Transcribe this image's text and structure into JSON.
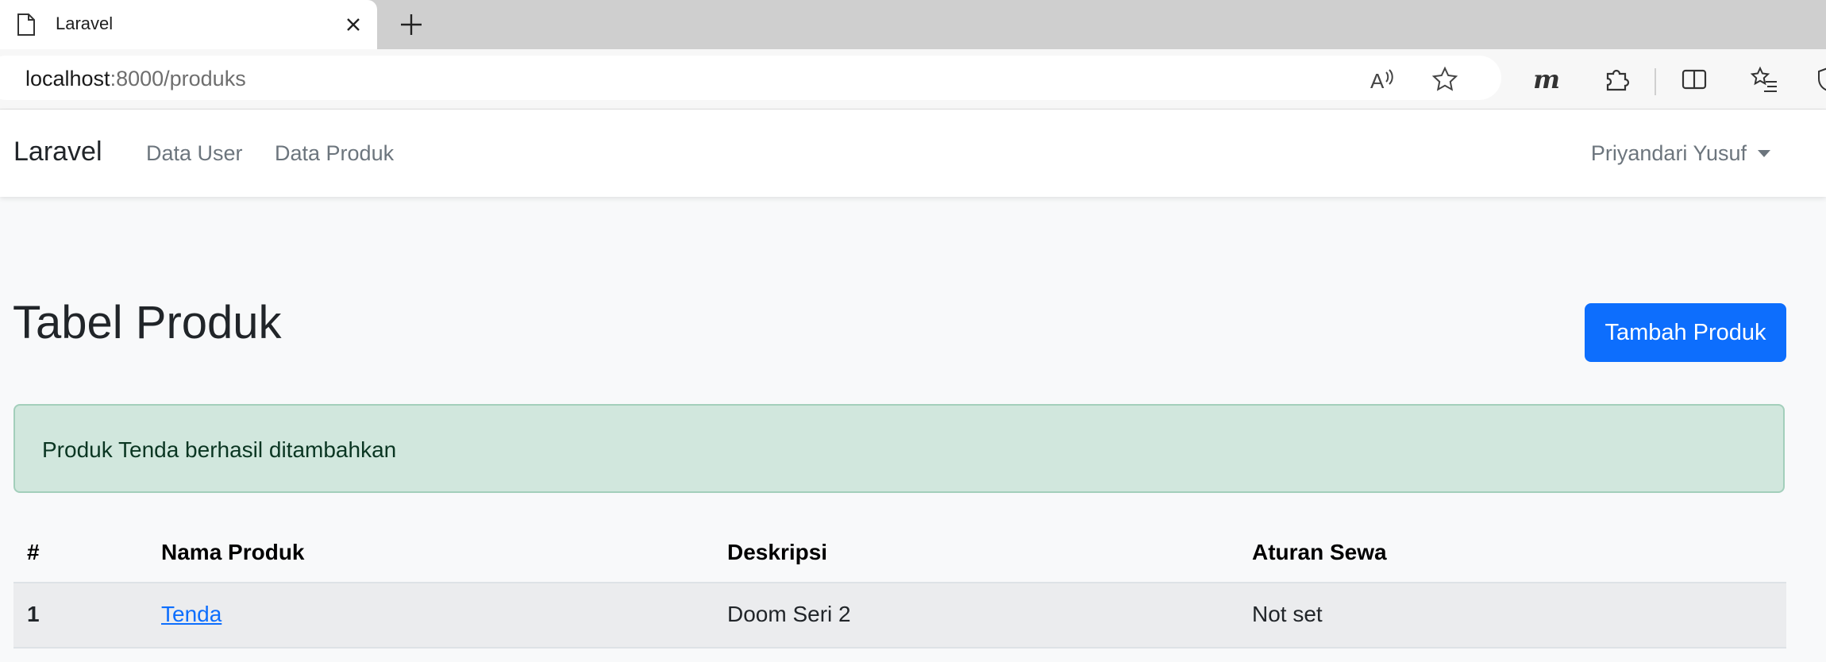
{
  "browser": {
    "tab_title": "Laravel",
    "url_host": "localhost",
    "url_path": ":8000/produks",
    "icons": [
      "page-icon",
      "close-icon",
      "plus-icon",
      "read-aloud-icon",
      "favorite-star-icon",
      "m-extension-icon",
      "extensions-puzzle-icon",
      "split-screen-icon",
      "favorites-list-icon",
      "shield-icon"
    ]
  },
  "navbar": {
    "brand": "Laravel",
    "links": [
      {
        "label": "Data User"
      },
      {
        "label": "Data Produk"
      }
    ],
    "user": "Priyandari Yusuf"
  },
  "main": {
    "title": "Tabel Produk",
    "add_button": "Tambah Produk",
    "alert": "Produk Tenda berhasil ditambahkan",
    "accent_color": "#0d6efd",
    "alert_color": "#d1e7dd",
    "table": {
      "headers": [
        "#",
        "Nama Produk",
        "Deskripsi",
        "Aturan Sewa"
      ],
      "rows": [
        {
          "no": "1",
          "name": "Tenda",
          "description": "Doom Seri 2",
          "rules": "Not set"
        }
      ]
    }
  }
}
